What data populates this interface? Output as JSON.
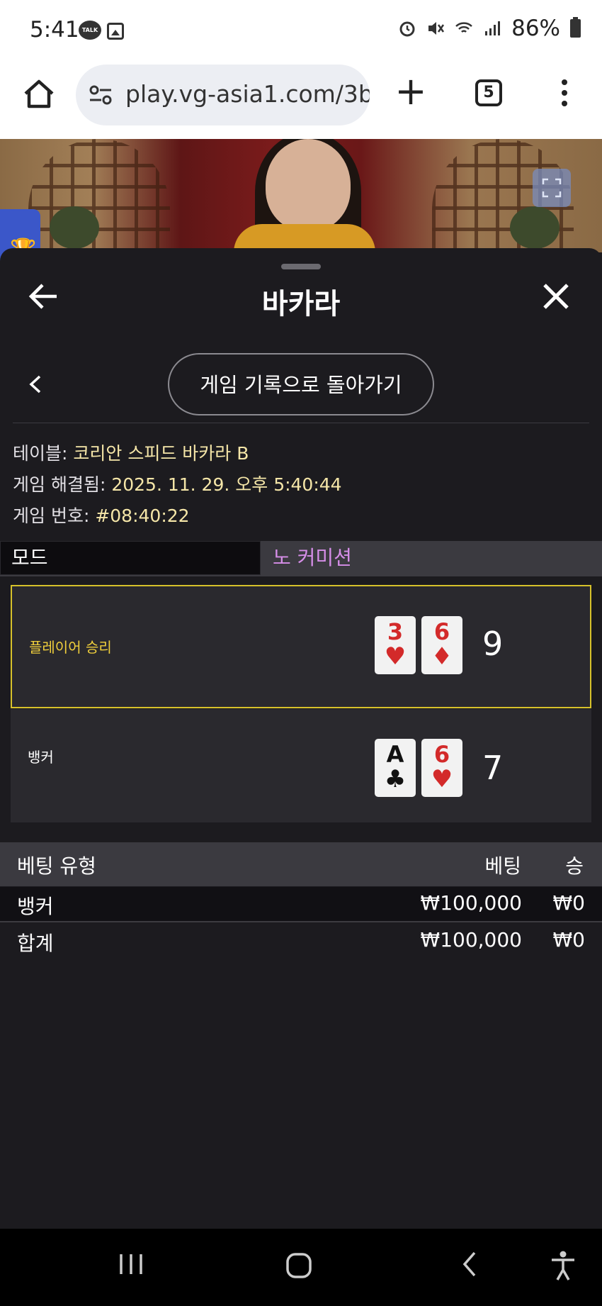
{
  "status_bar": {
    "time": "5:41",
    "talk_badge": "TALK",
    "battery": "86%"
  },
  "browser": {
    "url": "play.vg-asia1.com/3b",
    "tab_count": "5"
  },
  "sheet": {
    "title": "바카라",
    "back_to_history": "게임 기록으로 돌아가기",
    "info": [
      {
        "label": "테이블: ",
        "value": "코리안 스피드 바카라 B"
      },
      {
        "label": "게임 해결됨: ",
        "value": "2025. 11. 29. 오후 5:40:44"
      },
      {
        "label": "게임 번호: ",
        "value": "#08:40:22"
      }
    ],
    "mode": {
      "label": "모드",
      "value": "노 커미션"
    }
  },
  "results": {
    "player": {
      "label": "플레이어 승리",
      "cards": [
        {
          "rank": "3",
          "suit": "♥"
        },
        {
          "rank": "6",
          "suit": "♦"
        }
      ],
      "score": "9"
    },
    "banker": {
      "label": "뱅커",
      "cards": [
        {
          "rank": "A",
          "suit": "♣"
        },
        {
          "rank": "6",
          "suit": "♥"
        }
      ],
      "score": "7"
    }
  },
  "bets": {
    "headers": {
      "type": "베팅 유형",
      "bet": "베팅",
      "win": "승"
    },
    "rows": [
      {
        "type": "뱅커",
        "bet": "₩100,000",
        "win": "₩0"
      }
    ],
    "total": {
      "type": "합계",
      "bet": "₩100,000",
      "win": "₩0"
    }
  },
  "colors": {
    "accent_win_border": "#d6c12a",
    "mode_value": "#d68ee8",
    "info_value": "#f5e6a8"
  }
}
